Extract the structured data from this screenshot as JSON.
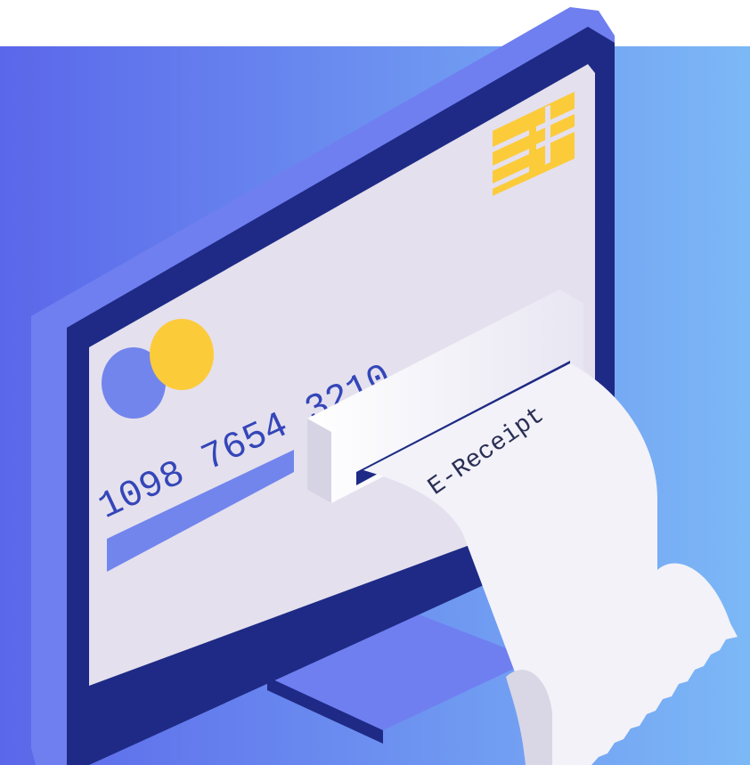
{
  "card": {
    "number_group_1": "1098",
    "number_group_2": "7654",
    "number_group_3": "3210"
  },
  "receipt": {
    "label": "E-Receipt"
  },
  "icons": [
    "card-chip-icon",
    "card-network-logo-icon"
  ],
  "colors": {
    "background_start": "#5b67ea",
    "background_end": "#7cb8f6",
    "monitor_frame": "#1e2a85",
    "monitor_bezel_side": "#6f7ff0",
    "card_face": "#e4e0ee",
    "chip": "#fccb3a",
    "logo_circle_blue": "#7285ec",
    "logo_circle_yellow": "#fccb3a",
    "receipt_paper": "#f3f2f9",
    "card_stripe": "#7285ec"
  }
}
